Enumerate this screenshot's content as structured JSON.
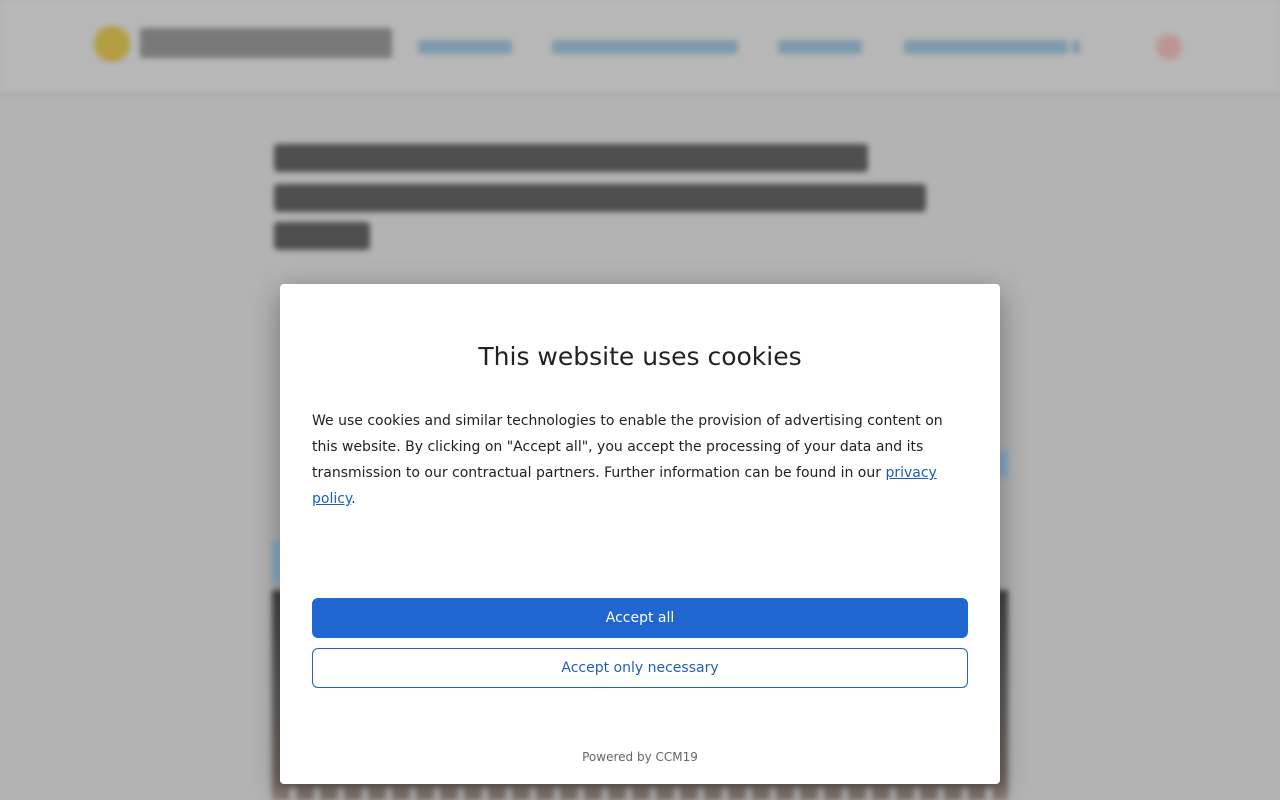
{
  "colors": {
    "accent": "#1f66d1",
    "link": "#1a5fb4",
    "overlay_bg": "#b9b9b9",
    "modal_bg": "#ffffff"
  },
  "background_page": {
    "logo_icon": "site-logo-icon",
    "search_icon": "search-icon",
    "nav_items": 4
  },
  "cookie_banner": {
    "title": "This website uses cookies",
    "body_before_link": "We use cookies and similar technologies to enable the provision of advertising content on this website. By clicking on \"Accept all\", you accept the processing of your data and its transmission to our contractual partners. Further information can be found in our ",
    "link_text": "privacy policy",
    "body_after_link": ".",
    "accept_all_label": "Accept all",
    "accept_necessary_label": "Accept only necessary",
    "powered_by": "Powered by CCM19"
  }
}
